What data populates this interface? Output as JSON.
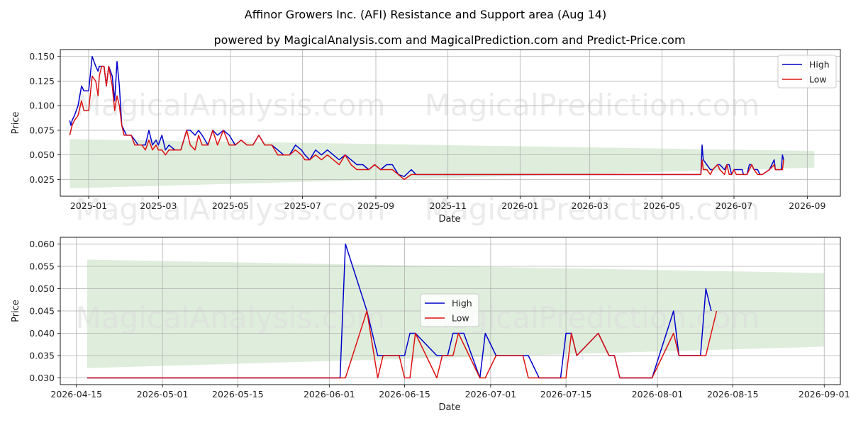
{
  "title": "Affinor Growers Inc. (AFI) Resistance and Support area (Aug 14)",
  "subtitle": "powered by MagicalAnalysis.com and MagicalPrediction.com and Predict-Price.com",
  "watermarks": [
    "MagicalAnalysis.com",
    "MagicalPrediction.com"
  ],
  "colors": {
    "high": "#0000cc",
    "low": "#dd1111",
    "band": "#d7ead3",
    "grid": "#b0b0b0"
  },
  "chart_data": [
    {
      "type": "line",
      "xlabel": "Date",
      "ylabel": "Price",
      "grid": true,
      "legend_placement": "top-right",
      "xlim": [
        "2024-12-08",
        "2026-09-29"
      ],
      "ylim": [
        0.008,
        0.157
      ],
      "x_ticks": [
        "2025-01",
        "2025-03",
        "2025-05",
        "2025-07",
        "2025-09",
        "2025-11",
        "2026-01",
        "2026-03",
        "2026-05",
        "2026-07",
        "2026-09"
      ],
      "y_ticks": [
        "0.025",
        "0.050",
        "0.075",
        "0.100",
        "0.125",
        "0.150"
      ],
      "band": {
        "x": [
          "2024-12-16",
          "2026-09-07"
        ],
        "upper": [
          0.066,
          0.054
        ],
        "lower": [
          0.016,
          0.037
        ]
      },
      "series": [
        {
          "name": "High",
          "x": [
            "2024-12-16",
            "2024-12-17",
            "2024-12-18",
            "2024-12-20",
            "2024-12-23",
            "2024-12-26",
            "2024-12-28",
            "2025-01-01",
            "2025-01-04",
            "2025-01-07",
            "2025-01-09",
            "2025-01-10",
            "2025-01-12",
            "2025-01-14",
            "2025-01-16",
            "2025-01-18",
            "2025-01-21",
            "2025-01-23",
            "2025-01-25",
            "2025-01-27",
            "2025-01-29",
            "2025-01-31",
            "2025-02-02",
            "2025-02-04",
            "2025-02-06",
            "2025-02-09",
            "2025-02-12",
            "2025-02-15",
            "2025-02-18",
            "2025-02-21",
            "2025-02-24",
            "2025-02-27",
            "2025-03-01",
            "2025-03-04",
            "2025-03-07",
            "2025-03-10",
            "2025-03-15",
            "2025-03-20",
            "2025-03-25",
            "2025-03-28",
            "2025-04-01",
            "2025-04-04",
            "2025-04-07",
            "2025-04-12",
            "2025-04-16",
            "2025-04-20",
            "2025-04-25",
            "2025-04-30",
            "2025-05-05",
            "2025-05-10",
            "2025-05-15",
            "2025-05-20",
            "2025-05-25",
            "2025-05-30",
            "2025-06-05",
            "2025-06-10",
            "2025-06-15",
            "2025-06-20",
            "2025-06-25",
            "2025-06-30",
            "2025-07-03",
            "2025-07-07",
            "2025-07-12",
            "2025-07-17",
            "2025-07-22",
            "2025-07-27",
            "2025-08-01",
            "2025-08-06",
            "2025-08-11",
            "2025-08-16",
            "2025-08-21",
            "2025-08-26",
            "2025-08-31",
            "2025-09-05",
            "2025-09-10",
            "2025-09-15",
            "2025-09-20",
            "2025-09-25",
            "2025-10-01",
            "2025-10-05",
            "2025-10-10",
            "2025-11-01",
            "2026-01-01",
            "2026-03-01",
            "2026-05-01",
            "2026-06-03",
            "2026-06-04",
            "2026-06-05",
            "2026-06-08",
            "2026-06-11",
            "2026-06-13",
            "2026-06-17",
            "2026-06-19",
            "2026-06-23",
            "2026-06-25",
            "2026-06-27",
            "2026-06-29",
            "2026-07-01",
            "2026-07-03",
            "2026-07-08",
            "2026-07-09",
            "2026-07-12",
            "2026-07-14",
            "2026-07-16",
            "2026-07-18",
            "2026-07-21",
            "2026-07-23",
            "2026-07-25",
            "2026-07-31",
            "2026-08-04",
            "2026-08-05",
            "2026-08-10",
            "2026-08-11",
            "2026-08-12"
          ],
          "values": [
            0.085,
            0.08,
            0.085,
            0.09,
            0.1,
            0.12,
            0.115,
            0.115,
            0.15,
            0.14,
            0.135,
            0.14,
            0.14,
            0.14,
            0.12,
            0.14,
            0.13,
            0.105,
            0.145,
            0.12,
            0.08,
            0.075,
            0.07,
            0.07,
            0.07,
            0.065,
            0.06,
            0.06,
            0.06,
            0.075,
            0.06,
            0.065,
            0.06,
            0.07,
            0.055,
            0.06,
            0.055,
            0.055,
            0.075,
            0.075,
            0.07,
            0.075,
            0.07,
            0.06,
            0.075,
            0.07,
            0.075,
            0.07,
            0.06,
            0.065,
            0.06,
            0.06,
            0.07,
            0.06,
            0.06,
            0.055,
            0.05,
            0.05,
            0.06,
            0.055,
            0.05,
            0.045,
            0.055,
            0.05,
            0.055,
            0.05,
            0.045,
            0.05,
            0.045,
            0.04,
            0.04,
            0.035,
            0.04,
            0.035,
            0.04,
            0.04,
            0.03,
            0.028,
            0.035,
            0.03,
            0.03,
            0.03,
            0.03,
            0.03,
            0.03,
            0.03,
            0.06,
            0.045,
            0.04,
            0.035,
            0.035,
            0.04,
            0.04,
            0.035,
            0.04,
            0.04,
            0.03,
            0.035,
            0.035,
            0.035,
            0.03,
            0.03,
            0.04,
            0.04,
            0.035,
            0.035,
            0.03,
            0.03,
            0.035,
            0.045,
            0.035,
            0.035,
            0.05,
            0.045
          ]
        },
        {
          "name": "Low",
          "x": [
            "2024-12-16",
            "2024-12-17",
            "2024-12-18",
            "2024-12-20",
            "2024-12-23",
            "2024-12-26",
            "2024-12-28",
            "2025-01-01",
            "2025-01-04",
            "2025-01-07",
            "2025-01-09",
            "2025-01-10",
            "2025-01-12",
            "2025-01-14",
            "2025-01-16",
            "2025-01-18",
            "2025-01-21",
            "2025-01-23",
            "2025-01-25",
            "2025-01-27",
            "2025-01-29",
            "2025-01-31",
            "2025-02-02",
            "2025-02-04",
            "2025-02-06",
            "2025-02-09",
            "2025-02-12",
            "2025-02-15",
            "2025-02-18",
            "2025-02-21",
            "2025-02-24",
            "2025-02-27",
            "2025-03-01",
            "2025-03-04",
            "2025-03-07",
            "2025-03-10",
            "2025-03-15",
            "2025-03-20",
            "2025-03-25",
            "2025-03-28",
            "2025-04-01",
            "2025-04-04",
            "2025-04-07",
            "2025-04-12",
            "2025-04-16",
            "2025-04-20",
            "2025-04-25",
            "2025-04-30",
            "2025-05-05",
            "2025-05-10",
            "2025-05-15",
            "2025-05-20",
            "2025-05-25",
            "2025-05-30",
            "2025-06-05",
            "2025-06-10",
            "2025-06-15",
            "2025-06-20",
            "2025-06-25",
            "2025-06-30",
            "2025-07-03",
            "2025-07-07",
            "2025-07-12",
            "2025-07-17",
            "2025-07-22",
            "2025-07-27",
            "2025-08-01",
            "2025-08-06",
            "2025-08-11",
            "2025-08-16",
            "2025-08-21",
            "2025-08-26",
            "2025-08-31",
            "2025-09-05",
            "2025-09-10",
            "2025-09-15",
            "2025-09-20",
            "2025-09-25",
            "2025-10-01",
            "2025-10-05",
            "2025-10-10",
            "2025-11-01",
            "2026-01-01",
            "2026-03-01",
            "2026-05-01",
            "2026-06-03",
            "2026-06-04",
            "2026-06-05",
            "2026-06-08",
            "2026-06-11",
            "2026-06-13",
            "2026-06-17",
            "2026-06-19",
            "2026-06-23",
            "2026-06-25",
            "2026-06-27",
            "2026-06-29",
            "2026-07-01",
            "2026-07-03",
            "2026-07-08",
            "2026-07-09",
            "2026-07-12",
            "2026-07-14",
            "2026-07-16",
            "2026-07-18",
            "2026-07-21",
            "2026-07-23",
            "2026-07-25",
            "2026-07-31",
            "2026-08-04",
            "2026-08-05",
            "2026-08-10",
            "2026-08-11",
            "2026-08-12"
          ],
          "values": [
            0.07,
            0.075,
            0.08,
            0.085,
            0.09,
            0.105,
            0.095,
            0.095,
            0.13,
            0.125,
            0.11,
            0.13,
            0.14,
            0.14,
            0.12,
            0.14,
            0.12,
            0.095,
            0.11,
            0.1,
            0.08,
            0.07,
            0.07,
            0.07,
            0.07,
            0.06,
            0.06,
            0.06,
            0.055,
            0.065,
            0.055,
            0.06,
            0.055,
            0.055,
            0.05,
            0.055,
            0.055,
            0.055,
            0.075,
            0.06,
            0.055,
            0.07,
            0.06,
            0.06,
            0.075,
            0.06,
            0.075,
            0.06,
            0.06,
            0.065,
            0.06,
            0.06,
            0.07,
            0.06,
            0.06,
            0.05,
            0.05,
            0.05,
            0.055,
            0.05,
            0.045,
            0.045,
            0.05,
            0.045,
            0.05,
            0.045,
            0.04,
            0.05,
            0.04,
            0.035,
            0.035,
            0.035,
            0.04,
            0.035,
            0.035,
            0.035,
            0.03,
            0.025,
            0.03,
            0.03,
            0.03,
            0.03,
            0.03,
            0.03,
            0.03,
            0.03,
            0.045,
            0.035,
            0.035,
            0.03,
            0.035,
            0.04,
            0.035,
            0.03,
            0.04,
            0.03,
            0.03,
            0.035,
            0.03,
            0.03,
            0.03,
            0.03,
            0.035,
            0.04,
            0.035,
            0.03,
            0.03,
            0.03,
            0.035,
            0.04,
            0.035,
            0.035,
            0.035,
            0.045
          ]
        }
      ]
    },
    {
      "type": "line",
      "xlabel": "Date",
      "ylabel": "Price",
      "grid": true,
      "legend_placement": "center",
      "xlim": [
        "2026-04-12",
        "2026-09-04"
      ],
      "ylim": [
        0.0285,
        0.0615
      ],
      "x_ticks": [
        "2026-04-15",
        "2026-05-01",
        "2026-05-15",
        "2026-06-01",
        "2026-06-15",
        "2026-07-01",
        "2026-07-15",
        "2026-08-01",
        "2026-08-15",
        "2026-09-01"
      ],
      "y_ticks": [
        "0.030",
        "0.035",
        "0.040",
        "0.045",
        "0.050",
        "0.055",
        "0.060"
      ],
      "band": {
        "x": [
          "2026-04-17",
          "2026-09-01"
        ],
        "upper": [
          0.0565,
          0.0535
        ],
        "lower": [
          0.0322,
          0.037
        ]
      },
      "series": [
        {
          "name": "High",
          "x": [
            "2026-04-17",
            "2026-06-03",
            "2026-06-04",
            "2026-06-08",
            "2026-06-10",
            "2026-06-14",
            "2026-06-15",
            "2026-06-16",
            "2026-06-17",
            "2026-06-21",
            "2026-06-23",
            "2026-06-24",
            "2026-06-25",
            "2026-06-26",
            "2026-06-29",
            "2026-06-30",
            "2026-07-02",
            "2026-07-07",
            "2026-07-08",
            "2026-07-10",
            "2026-07-11",
            "2026-07-14",
            "2026-07-15",
            "2026-07-16",
            "2026-07-17",
            "2026-07-21",
            "2026-07-23",
            "2026-07-24",
            "2026-07-25",
            "2026-07-31",
            "2026-08-04",
            "2026-08-05",
            "2026-08-09",
            "2026-08-10",
            "2026-08-11"
          ],
          "values": [
            0.03,
            0.03,
            0.06,
            0.045,
            0.035,
            0.035,
            0.035,
            0.04,
            0.04,
            0.035,
            0.035,
            0.04,
            0.04,
            0.04,
            0.03,
            0.04,
            0.035,
            0.035,
            0.035,
            0.03,
            0.03,
            0.03,
            0.04,
            0.04,
            0.035,
            0.04,
            0.035,
            0.035,
            0.03,
            0.03,
            0.045,
            0.035,
            0.035,
            0.05,
            0.045
          ]
        },
        {
          "name": "Low",
          "x": [
            "2026-04-17",
            "2026-06-04",
            "2026-06-08",
            "2026-06-10",
            "2026-06-11",
            "2026-06-14",
            "2026-06-15",
            "2026-06-16",
            "2026-06-17",
            "2026-06-21",
            "2026-06-22",
            "2026-06-24",
            "2026-06-25",
            "2026-06-29",
            "2026-06-30",
            "2026-07-02",
            "2026-07-07",
            "2026-07-08",
            "2026-07-10",
            "2026-07-15",
            "2026-07-16",
            "2026-07-17",
            "2026-07-21",
            "2026-07-23",
            "2026-07-24",
            "2026-07-25",
            "2026-07-31",
            "2026-08-04",
            "2026-08-05",
            "2026-08-10",
            "2026-08-12"
          ],
          "values": [
            0.03,
            0.03,
            0.045,
            0.03,
            0.035,
            0.035,
            0.03,
            0.03,
            0.04,
            0.03,
            0.035,
            0.035,
            0.04,
            0.03,
            0.03,
            0.035,
            0.035,
            0.03,
            0.03,
            0.03,
            0.04,
            0.035,
            0.04,
            0.035,
            0.035,
            0.03,
            0.03,
            0.04,
            0.035,
            0.035,
            0.045
          ]
        }
      ]
    }
  ]
}
